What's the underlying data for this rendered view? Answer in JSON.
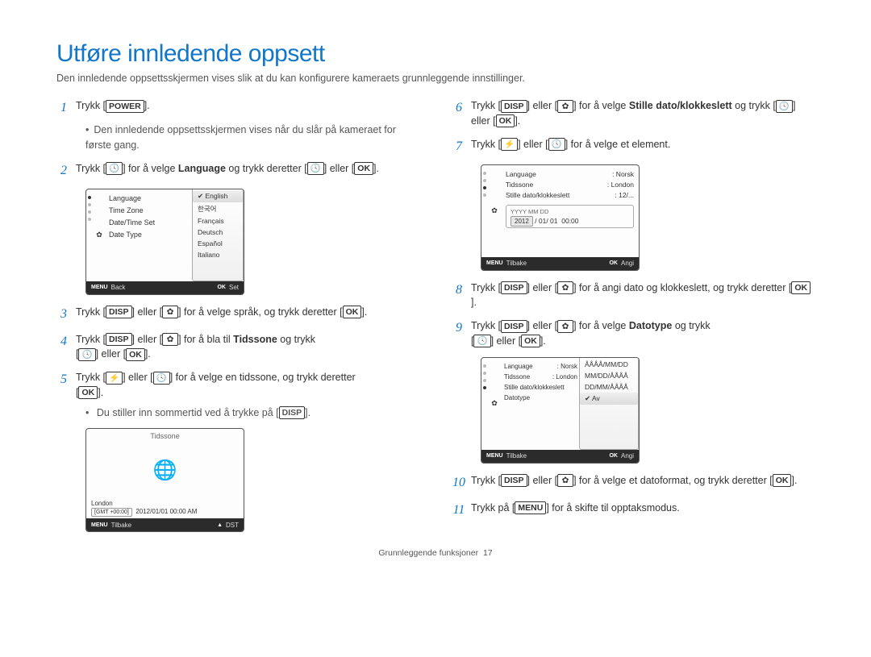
{
  "title": "Utføre innledende oppsett",
  "intro": "Den innledende oppsettsskjermen vises slik at du kan konfigurere kameraets grunnleggende innstillinger.",
  "keys": {
    "power": "POWER",
    "ok": "OK",
    "disp": "DISP",
    "menu": "MENU"
  },
  "icons": {
    "timer": "🕓",
    "flower": "✿",
    "flash": "⚡"
  },
  "steps": {
    "s1": "Trykk [",
    "s1b": "].",
    "s1_note": "Den innledende oppsettsskjermen vises når du slår på kameraet for første gang.",
    "s2_a": "Trykk [",
    "s2_b": "] for å velge ",
    "s2_lang": "Language",
    "s2_c": " og trykk deretter [",
    "s2_d": "] eller [",
    "s2_e": "].",
    "s3_a": "Trykk [",
    "s3_b": "] eller [",
    "s3_c": "] for å velge språk, og trykk deretter [",
    "s3_d": "].",
    "s4_a": "Trykk [",
    "s4_b": "] eller [",
    "s4_c": "] for å bla til ",
    "s4_tid": "Tidssone",
    "s4_d": " og trykk",
    "s4_e": "[",
    "s4_f": "] eller [",
    "s4_g": "].",
    "s5_a": "Trykk [",
    "s5_b": "] eller [",
    "s5_c": "] for å velge en tidssone, og trykk deretter",
    "s5_d": "[",
    "s5_e": "].",
    "s5_note": "Du stiller inn sommertid ved å trykke på [",
    "s5_note_b": "].",
    "s6_a": "Trykk [",
    "s6_b": "] eller [",
    "s6_c": "] for å velge ",
    "s6_still": "Stille dato/klokkeslett",
    "s6_d": " og trykk [",
    "s6_e": "] eller [",
    "s6_f": "].",
    "s7_a": "Trykk [",
    "s7_b": "] eller [",
    "s7_c": "] for å velge et element.",
    "s8_a": "Trykk [",
    "s8_b": "] eller [",
    "s8_c": "] for å angi dato og klokkeslett, og trykk deretter [",
    "s8_d": "].",
    "s9_a": "Trykk [",
    "s9_b": "] eller [",
    "s9_c": "] for å velge ",
    "s9_dato": "Datotype",
    "s9_d": " og trykk",
    "s9_e": "[",
    "s9_f": "] eller [",
    "s9_g": "].",
    "s10_a": "Trykk [",
    "s10_b": "] eller [",
    "s10_c": "] for å velge et datoformat, og trykk deretter [",
    "s10_d": "].",
    "s11_a": "Trykk på [",
    "s11_b": "] for å skifte til opptaksmodus."
  },
  "screen1": {
    "menu": [
      "Language",
      "Time Zone",
      "Date/Time Set",
      "Date Type"
    ],
    "drop": [
      "English",
      "한국어",
      "Français",
      "Deutsch",
      "Español",
      "Italiano"
    ],
    "footer_left_btn": "MENU",
    "footer_left": "Back",
    "footer_right_btn": "OK",
    "footer_right": "Set",
    "gear": "✿"
  },
  "screen2": {
    "title": "Tidssone",
    "loc": "London",
    "gmt": "[GMT +00:00]",
    "time": "2012/01/01   00:00 AM",
    "footer_left_btn": "MENU",
    "footer_left": "Tilbake",
    "footer_right_btn": "▲",
    "footer_right": "DST"
  },
  "screen3": {
    "rows": [
      [
        "Language",
        ": Norsk"
      ],
      [
        "Tidssone",
        ": London"
      ],
      [
        "Stille dato/klokkeslett",
        ": 12/..."
      ]
    ],
    "fmt": "YYYY MM DD",
    "date": "2012 / 01/ 01   00:00",
    "date_hl": "2012",
    "footer_left_btn": "MENU",
    "footer_left": "Tilbake",
    "footer_right_btn": "OK",
    "footer_right": "Angi"
  },
  "screen4": {
    "rows": [
      [
        "Language",
        ": Norsk"
      ],
      [
        "Tidssone",
        ": London"
      ],
      [
        "Stille dato/klokkeslett",
        ""
      ],
      [
        "Datotype",
        ""
      ]
    ],
    "drop": [
      "ÅÅÅÅ/MM/DD",
      "MM/DD/ÅÅÅÅ",
      "DD/MM/ÅÅÅÅ",
      "Av"
    ],
    "footer_left_btn": "MENU",
    "footer_left": "Tilbake",
    "footer_right_btn": "OK",
    "footer_right": "Angi"
  },
  "footer": {
    "label": "Grunnleggende funksjoner",
    "page": "17"
  }
}
